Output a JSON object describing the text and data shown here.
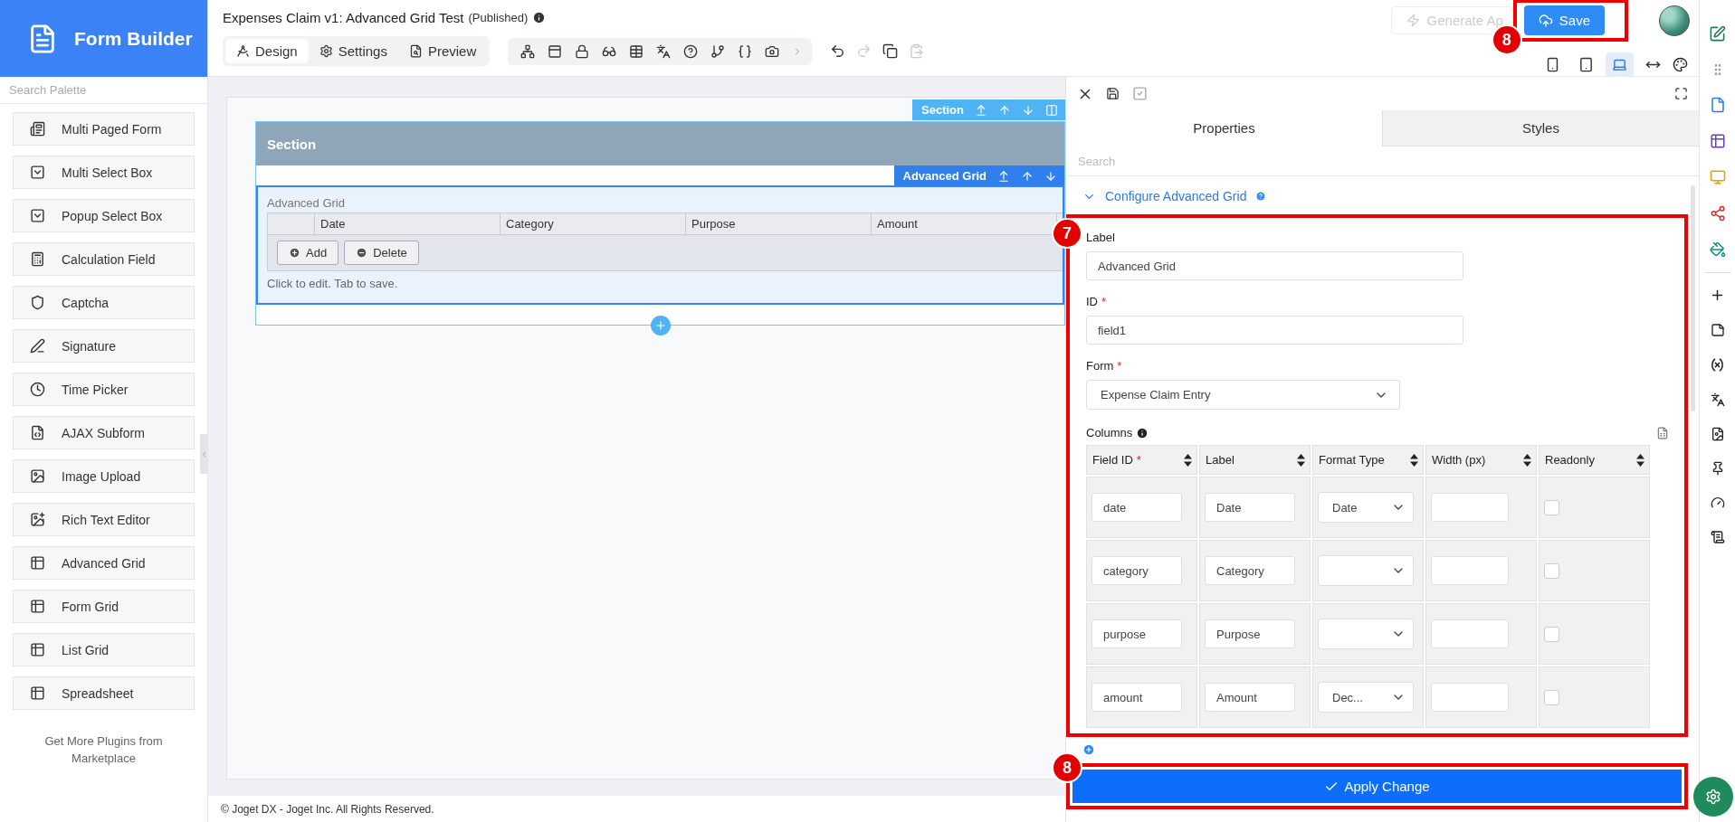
{
  "brand": {
    "title": "Form Builder"
  },
  "palette": {
    "search_placeholder": "Search Palette",
    "items": [
      {
        "label": "Multi Paged Form"
      },
      {
        "label": "Multi Select Box"
      },
      {
        "label": "Popup Select Box"
      },
      {
        "label": "Calculation Field"
      },
      {
        "label": "Captcha"
      },
      {
        "label": "Signature"
      },
      {
        "label": "Time Picker"
      },
      {
        "label": "AJAX Subform"
      },
      {
        "label": "Image Upload"
      },
      {
        "label": "Rich Text Editor"
      },
      {
        "label": "Advanced Grid"
      },
      {
        "label": "Form Grid"
      },
      {
        "label": "List Grid"
      },
      {
        "label": "Spreadsheet"
      }
    ],
    "more_link": "Get More Plugins from Marketplace"
  },
  "header": {
    "form_title": "Expenses Claim v1: Advanced Grid Test",
    "status": "(Published)",
    "mode_tabs": [
      {
        "label": "Design",
        "selected": true
      },
      {
        "label": "Settings",
        "selected": false
      },
      {
        "label": "Preview",
        "selected": false
      }
    ],
    "edit_tools": [
      {
        "kind": "undo",
        "disabled": false
      },
      {
        "kind": "redo",
        "disabled": true
      },
      {
        "kind": "copy",
        "disabled": false
      },
      {
        "kind": "paste",
        "disabled": true
      }
    ],
    "generate_button": {
      "label": "Generate Ap",
      "disabled": true
    },
    "save_button": {
      "label": "Save",
      "callout": "8"
    },
    "devices": [
      {
        "kind": "mobile",
        "selected": false
      },
      {
        "kind": "tablet",
        "selected": false
      },
      {
        "kind": "laptop",
        "selected": true
      },
      {
        "kind": "full-width",
        "selected": false
      }
    ]
  },
  "canvas": {
    "section_tag": "Section",
    "section_title": "Section",
    "element_tag": "Advanced Grid",
    "grid": {
      "label": "Advanced Grid",
      "columns": [
        "Date",
        "Category",
        "Purpose",
        "Amount"
      ],
      "buttons": [
        "Add",
        "Delete"
      ],
      "hint": "Click to edit. Tab to save."
    }
  },
  "properties": {
    "tabs": [
      {
        "label": "Properties",
        "selected": true
      },
      {
        "label": "Styles",
        "selected": false
      }
    ],
    "search_placeholder": "Search",
    "group_title": "Configure Advanced Grid",
    "callout": "7",
    "fields": [
      {
        "kind": "text",
        "label": "Label",
        "value": "Advanced Grid"
      },
      {
        "kind": "text",
        "label": "ID",
        "required_mark": "*",
        "value": "field1"
      },
      {
        "kind": "select",
        "label": "Form",
        "required_mark": "*",
        "value": "Expense Claim Entry"
      }
    ],
    "columns": {
      "label": "Columns",
      "headers": [
        {
          "label": "Field ID",
          "required_mark": "*"
        },
        {
          "label": "Label"
        },
        {
          "label": "Format Type"
        },
        {
          "label": "Width (px)"
        },
        {
          "label": "Readonly"
        }
      ],
      "rows": [
        {
          "field_id": "date",
          "label": "Date",
          "format": "Date",
          "readonly": false
        },
        {
          "field_id": "category",
          "label": "Category",
          "readonly": false
        },
        {
          "field_id": "purpose",
          "label": "Purpose",
          "readonly": false
        },
        {
          "field_id": "amount",
          "label": "Amount",
          "format": "Dec...",
          "readonly": false
        }
      ]
    },
    "apply_button": {
      "label": "Apply Change",
      "callout": "8"
    }
  },
  "footer": "© Joget DX - Joget Inc. All Rights Reserved."
}
